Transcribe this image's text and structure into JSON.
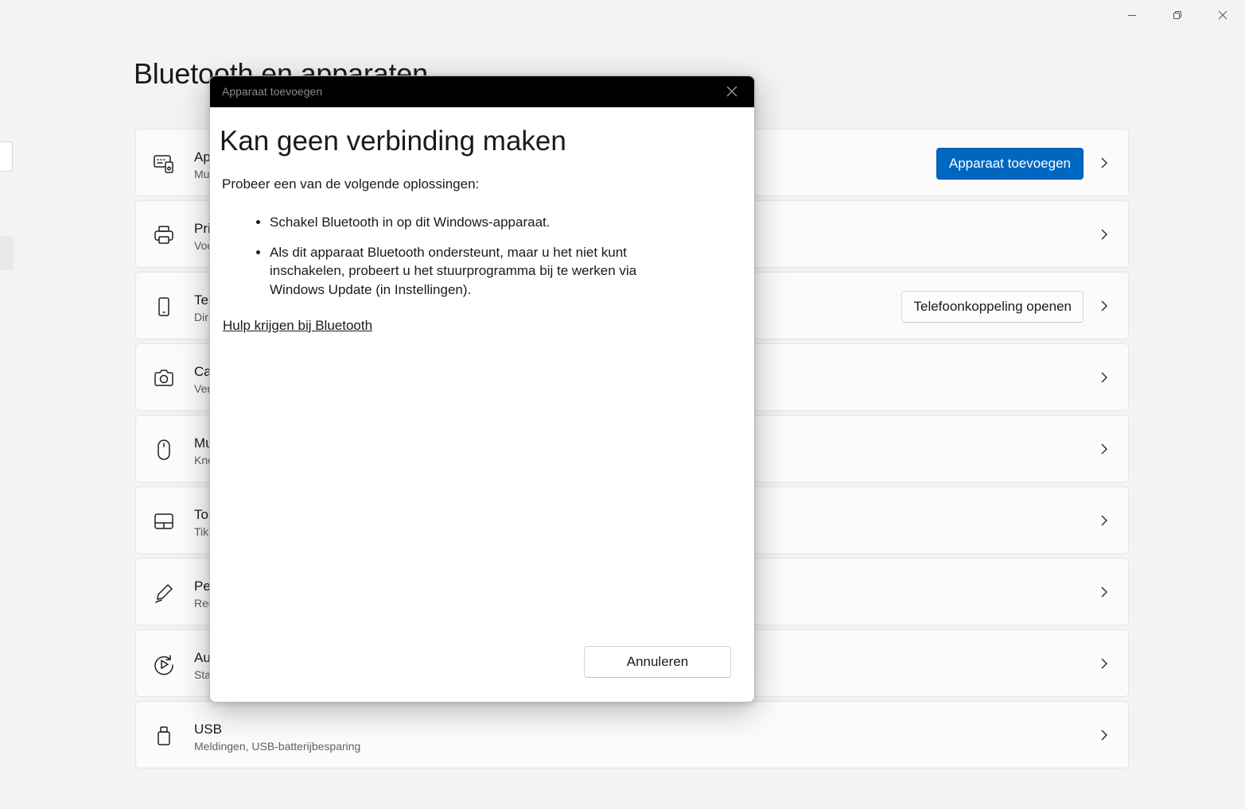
{
  "window": {
    "minimize_icon": "minimize-icon",
    "maximize_icon": "restore-icon",
    "close_icon": "close-icon"
  },
  "page": {
    "title": "Bluetooth en apparaten"
  },
  "cards": [
    {
      "icon": "devices-icon",
      "title": "Ap",
      "subtitle": "Mu",
      "button": "Apparaat toevoegen"
    },
    {
      "icon": "printer-icon",
      "title": "Pri",
      "subtitle": "Voo"
    },
    {
      "icon": "phone-icon",
      "title": "Tel",
      "subtitle": "Dir",
      "button": "Telefoonkoppeling openen"
    },
    {
      "icon": "camera-icon",
      "title": "Ca",
      "subtitle": "Ver"
    },
    {
      "icon": "mouse-icon",
      "title": "Mu",
      "subtitle": "Kno"
    },
    {
      "icon": "touchpad-icon",
      "title": "To",
      "subtitle": "Tik"
    },
    {
      "icon": "pen-icon",
      "title": "Pe",
      "subtitle": "Rec"
    },
    {
      "icon": "autoplay-icon",
      "title": "Au",
      "subtitle": "Sta"
    },
    {
      "icon": "usb-icon",
      "title": "USB",
      "subtitle": "Meldingen, USB-batterijbesparing"
    }
  ],
  "dialog": {
    "window_title": "Apparaat toevoegen",
    "heading": "Kan geen verbinding maken",
    "intro": "Probeer een van de volgende oplossingen:",
    "bullets": [
      "Schakel Bluetooth in op dit Windows-apparaat.",
      "Als dit apparaat Bluetooth ondersteunt, maar u het niet kunt inschakelen, probeert u het stuurprogramma bij te werken via Windows Update (in Instellingen)."
    ],
    "help_link": "Hulp krijgen bij Bluetooth",
    "cancel_label": "Annuleren"
  }
}
